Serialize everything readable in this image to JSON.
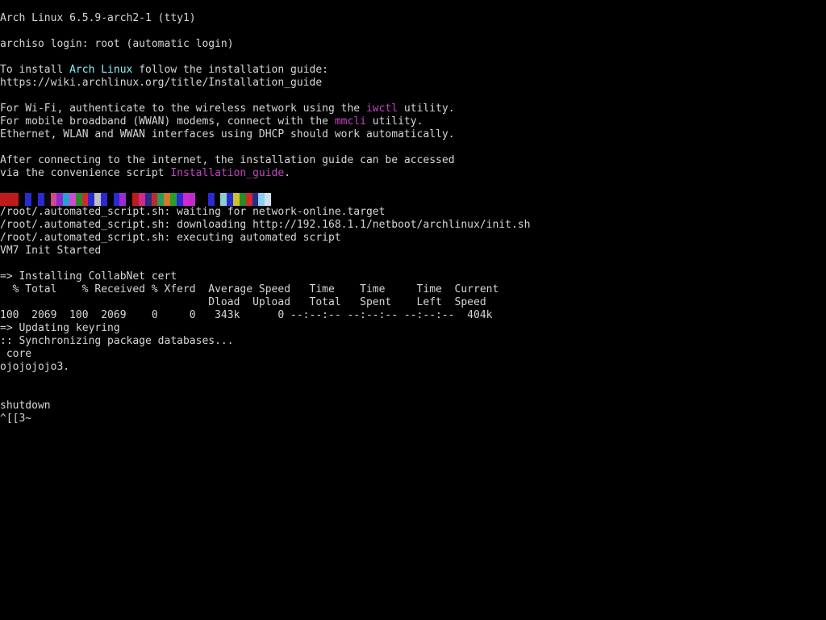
{
  "console": {
    "lines": [
      {
        "segments": [
          {
            "text": "Arch Linux 6.5.9-arch2-1 (tty1)"
          }
        ]
      },
      {
        "segments": [
          {
            "text": ""
          }
        ]
      },
      {
        "segments": [
          {
            "text": "archiso login: root (automatic login)"
          }
        ]
      },
      {
        "segments": [
          {
            "text": ""
          }
        ]
      },
      {
        "segments": [
          {
            "text": "To install "
          },
          {
            "text": "Arch Linux",
            "style": "cyan"
          },
          {
            "text": " follow the installation guide:"
          }
        ]
      },
      {
        "segments": [
          {
            "text": "https://wiki.archlinux.org/title/Installation_guide"
          }
        ]
      },
      {
        "segments": [
          {
            "text": ""
          }
        ]
      },
      {
        "segments": [
          {
            "text": "For Wi-Fi, authenticate to the wireless network using the "
          },
          {
            "text": "iwctl",
            "style": "magenta"
          },
          {
            "text": " utility."
          }
        ]
      },
      {
        "segments": [
          {
            "text": "For mobile broadband (WWAN) modems, connect with the "
          },
          {
            "text": "mmcli",
            "style": "magenta"
          },
          {
            "text": " utility."
          }
        ]
      },
      {
        "segments": [
          {
            "text": "Ethernet, WLAN and WWAN interfaces using DHCP should work automatically."
          }
        ]
      },
      {
        "segments": [
          {
            "text": ""
          }
        ]
      },
      {
        "segments": [
          {
            "text": "After connecting to the internet, the installation guide can be accessed"
          }
        ]
      },
      {
        "segments": [
          {
            "text": "via the convenience script "
          },
          {
            "text": "Installation_guide",
            "style": "magenta"
          },
          {
            "text": "."
          }
        ]
      },
      {
        "segments": [
          {
            "text": ""
          }
        ]
      },
      {
        "noise": true
      },
      {
        "segments": [
          {
            "text": "/root/.automated_script.sh: waiting for network-online.target"
          }
        ]
      },
      {
        "segments": [
          {
            "text": "/root/.automated_script.sh: downloading http://192.168.1.1/netboot/archlinux/init.sh"
          }
        ]
      },
      {
        "segments": [
          {
            "text": "/root/.automated_script.sh: executing automated script"
          }
        ]
      },
      {
        "segments": [
          {
            "text": "VM7 Init Started"
          }
        ]
      },
      {
        "segments": [
          {
            "text": ""
          }
        ]
      },
      {
        "segments": [
          {
            "text": "=> Installing CollabNet cert"
          }
        ]
      },
      {
        "segments": [
          {
            "text": "  % Total    % Received % Xferd  Average Speed   Time    Time     Time  Current"
          }
        ]
      },
      {
        "segments": [
          {
            "text": "                                 Dload  Upload   Total   Spent    Left  Speed"
          }
        ]
      },
      {
        "segments": [
          {
            "text": "100  2069  100  2069    0     0   343k      0 --:--:-- --:--:-- --:--:--  404k"
          }
        ]
      },
      {
        "segments": [
          {
            "text": "=> Updating keyring"
          }
        ]
      },
      {
        "segments": [
          {
            "text": ":: Synchronizing package databases..."
          }
        ]
      },
      {
        "segments": [
          {
            "text": " core"
          }
        ]
      },
      {
        "segments": [
          {
            "text": "ojojojojo3."
          }
        ]
      },
      {
        "segments": [
          {
            "text": ""
          }
        ]
      },
      {
        "segments": [
          {
            "text": ""
          }
        ]
      },
      {
        "segments": [
          {
            "text": "shutdown"
          }
        ]
      },
      {
        "segments": [
          {
            "text": "^[[3~"
          }
        ]
      }
    ]
  },
  "colors": {
    "background": "#000000",
    "text": "#d6d6d6",
    "cyan": "#7ff6ff",
    "magenta": "#c244c6"
  },
  "noise_colors": [
    "#c01a1a",
    "#c01a1a",
    "#c01a1a",
    "#000000",
    "#2a2ad0",
    "#000000",
    "#2a2ad0",
    "#0a0a0a",
    "#d04a8a",
    "#8a2ad0",
    "#2aa0d0",
    "#d04ad0",
    "#2a8a2a",
    "#d02a2a",
    "#2a2ad0",
    "#c0c0c0",
    "#2a2ad0",
    "#000000",
    "#2a2ad0",
    "#a02ad0",
    "#000000",
    "#c01a1a",
    "#d02a8a",
    "#2a2a8a",
    "#c02a2a",
    "#2a9a5a",
    "#d07a2a",
    "#2aa02a",
    "#2a2ad0",
    "#d02ad0",
    "#c02ad0",
    "#000000",
    "#000000",
    "#2a2ad0",
    "#000000",
    "#8ad0d0",
    "#2a2ad0",
    "#d0c02a",
    "#2a8a2a",
    "#d02a2a",
    "#2a2a8a",
    "#8ad0f0",
    "#d0e0f0"
  ]
}
